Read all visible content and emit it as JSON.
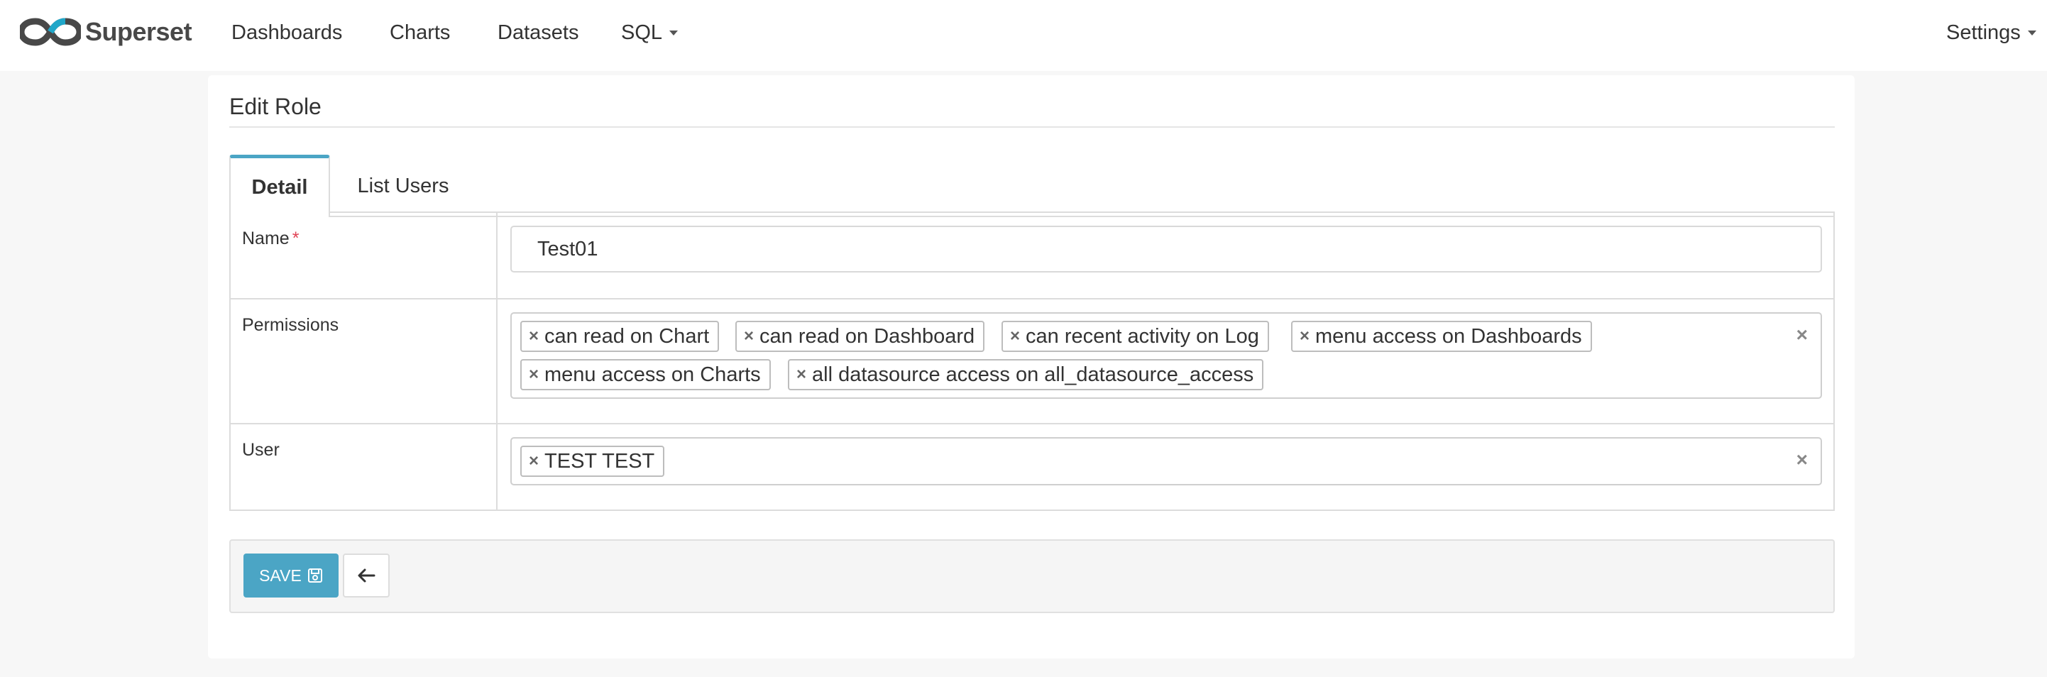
{
  "brand": {
    "name": "Superset",
    "logo_icon": "superset-infinity-logo",
    "logo_color": "#484848",
    "logo_accent": "#20a7c9"
  },
  "nav": {
    "dashboards": "Dashboards",
    "charts": "Charts",
    "datasets": "Datasets",
    "sql": "SQL",
    "settings": "Settings"
  },
  "page": {
    "title": "Edit Role"
  },
  "tabs": [
    {
      "label": "Detail",
      "active": true
    },
    {
      "label": "List Users",
      "active": false
    }
  ],
  "form": {
    "name": {
      "label": "Name",
      "required_mark": "*",
      "value": "Test01"
    },
    "permissions": {
      "label": "Permissions",
      "selected": [
        "can read on Chart",
        "can read on Dashboard",
        "can recent activity on Log",
        "menu access on Dashboards",
        "menu access on Charts",
        "all datasource access on all_datasource_access"
      ],
      "clear_glyph": "×"
    },
    "user": {
      "label": "User",
      "selected": [
        "TEST TEST"
      ],
      "clear_glyph": "×"
    },
    "chip_remove_glyph": "×"
  },
  "footer": {
    "save_label": "SAVE",
    "save_icon": "floppy-disk-icon",
    "back_icon": "arrow-left-icon"
  },
  "colors": {
    "accent": "#4ba5c5",
    "required": "#e04355"
  }
}
